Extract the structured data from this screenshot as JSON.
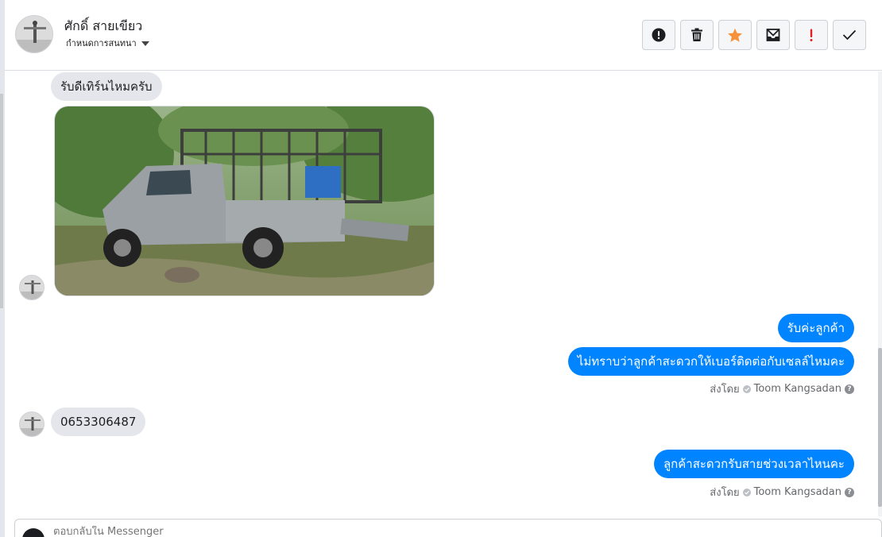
{
  "header": {
    "contact_name": "ศักดิ์ สายเขียว",
    "label_dropdown": "กำหนดการสนทนา",
    "actions": [
      {
        "name": "mark-spam-button",
        "icon": "alert-circle-icon"
      },
      {
        "name": "delete-button",
        "icon": "trash-icon"
      },
      {
        "name": "star-button",
        "icon": "star-icon"
      },
      {
        "name": "mark-unread-button",
        "icon": "envelope-icon"
      },
      {
        "name": "mark-important-button",
        "icon": "exclamation-icon"
      },
      {
        "name": "mark-done-button",
        "icon": "check-icon"
      }
    ]
  },
  "colors": {
    "outgoing_bubble": "#0084ff",
    "incoming_bubble": "#e4e6eb",
    "star": "#f7923b",
    "important": "#e02020"
  },
  "messages": {
    "m1": "รับดีเทิร์นไหมครับ",
    "m2": "รับค่ะลูกค้า",
    "m3": "ไม่ทราบว่าลูกค้าสะดวกให้เบอร์ติดต่อกับเซลล์ไหมคะ",
    "m4": "0653306487",
    "m5": "ลูกค้าสะดวกรับสายช่วงเวลาไหนคะ"
  },
  "sent_by": {
    "prefix": "ส่งโดย",
    "agent": "Toom Kangsadan"
  },
  "composer": {
    "placeholder": "ตอบกลับใน Messenger"
  }
}
